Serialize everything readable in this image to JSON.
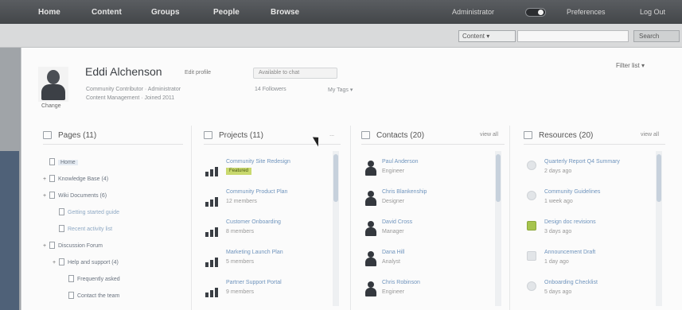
{
  "topbar": {
    "nav": [
      "Home",
      "Content",
      "Groups",
      "People",
      "Browse"
    ],
    "right_text": [
      "Administrator",
      "Preferences",
      "Log Out"
    ]
  },
  "search": {
    "scope": "Content ▾",
    "placeholder": "",
    "button": "Search"
  },
  "profile": {
    "name": "Eddi Alchenson",
    "action": "Edit profile",
    "status_tag": "Available to chat",
    "change_photo": "Change",
    "details_line1": "Community Contributor · Administrator",
    "details_line2": "Content Management · Joined 2011",
    "followers": "14 Followers",
    "tags_menu": "My Tags ▾",
    "filter": "Filter list ▾"
  },
  "panels": {
    "pages": {
      "title": "Pages (11)",
      "items": [
        {
          "label": "Home",
          "indent": 0,
          "expander": "",
          "style": "selected"
        },
        {
          "label": "Knowledge Base (4)",
          "indent": 0,
          "expander": "+",
          "style": "normal"
        },
        {
          "label": "Wiki Documents (6)",
          "indent": 0,
          "expander": "+",
          "style": "normal"
        },
        {
          "label": "Getting started guide",
          "indent": 1,
          "expander": "",
          "style": "blue"
        },
        {
          "label": "Recent activity list",
          "indent": 1,
          "expander": "",
          "style": "blue"
        },
        {
          "label": "Discussion Forum",
          "indent": 0,
          "expander": "+",
          "style": "normal"
        },
        {
          "label": "Help and support (4)",
          "indent": 1,
          "expander": "+",
          "style": "normal"
        },
        {
          "label": "Frequently asked",
          "indent": 2,
          "expander": "",
          "style": "normal"
        },
        {
          "label": "Contact the team",
          "indent": 2,
          "expander": "",
          "style": "normal"
        }
      ]
    },
    "projects": {
      "title": "Projects (11)",
      "link": "...",
      "items": [
        {
          "title": "Community Site Redesign",
          "badge": "Featured",
          "sub": ""
        },
        {
          "title": "Community Product Plan",
          "badge": "",
          "sub": "12 members"
        },
        {
          "title": "Customer Onboarding",
          "badge": "",
          "sub": "8 members"
        },
        {
          "title": "Marketing Launch Plan",
          "badge": "",
          "sub": "5 members"
        },
        {
          "title": "Partner Support Portal",
          "badge": "",
          "sub": "9 members"
        }
      ]
    },
    "contacts": {
      "title": "Contacts (20)",
      "link": "view all",
      "items": [
        {
          "name": "Paul Anderson",
          "role": "Engineer"
        },
        {
          "name": "Chris Blankenship",
          "role": "Designer"
        },
        {
          "name": "David Cross",
          "role": "Manager"
        },
        {
          "name": "Dana Hill",
          "role": "Analyst"
        },
        {
          "name": "Chris Robinson",
          "role": "Engineer"
        }
      ]
    },
    "resources": {
      "title": "Resources (20)",
      "link": "view all",
      "items": [
        {
          "title": "Quarterly Report Q4 Summary",
          "sub": "2 days ago",
          "icon": "round"
        },
        {
          "title": "Community Guidelines",
          "sub": "1 week ago",
          "icon": "round"
        },
        {
          "title": "Design doc revisions",
          "sub": "3 days ago",
          "icon": "green"
        },
        {
          "title": "Announcement Draft",
          "sub": "1 day ago",
          "icon": "square"
        },
        {
          "title": "Onboarding Checklist",
          "sub": "5 days ago",
          "icon": "round"
        }
      ]
    }
  },
  "colors": {
    "topbar": "#4a4d51",
    "link_blue": "#6f94bd",
    "badge_green": "#c9d96e"
  }
}
